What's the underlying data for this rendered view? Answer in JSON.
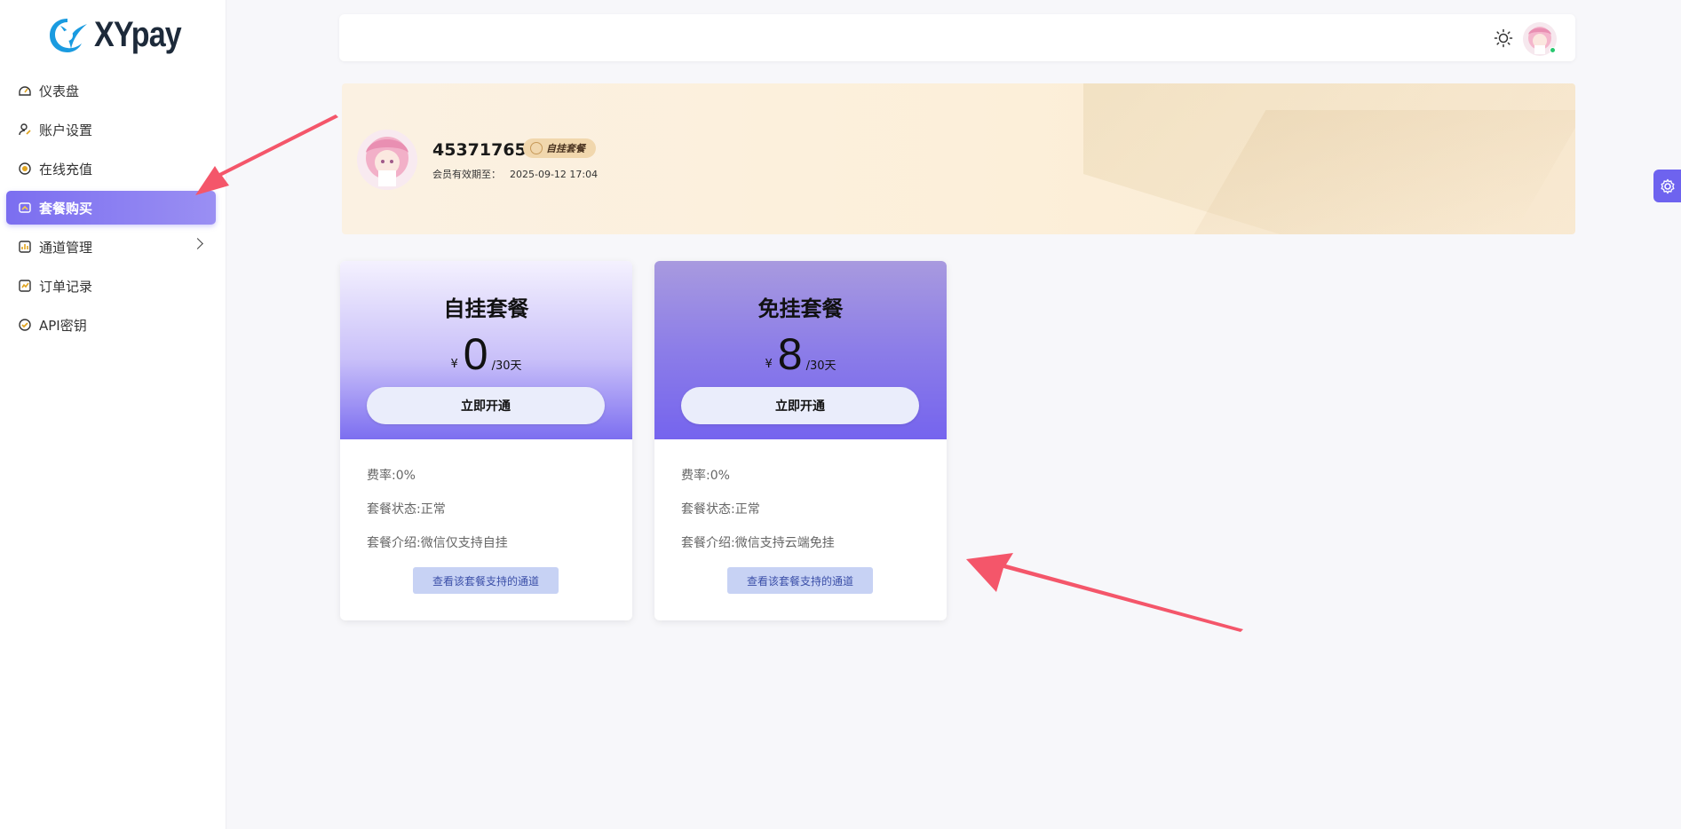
{
  "app": {
    "logo_text": "XYpay"
  },
  "sidebar": {
    "items": [
      {
        "label": "仪表盘",
        "icon": "dashboard-icon"
      },
      {
        "label": "账户设置",
        "icon": "user-settings-icon"
      },
      {
        "label": "在线充值",
        "icon": "coin-icon"
      },
      {
        "label": "套餐购买",
        "icon": "package-icon",
        "active": true
      },
      {
        "label": "通道管理",
        "icon": "chart-icon",
        "has_submenu": true
      },
      {
        "label": "订单记录",
        "icon": "order-icon"
      },
      {
        "label": "API密钥",
        "icon": "key-icon"
      }
    ]
  },
  "header": {
    "theme_icon": "sun-icon"
  },
  "banner": {
    "username": "453717652",
    "badge": "自挂套餐",
    "expire_label": "会员有效期至：",
    "expire_value": "2025-09-12 17:04"
  },
  "cards": [
    {
      "title": "自挂套餐",
      "currency": "¥",
      "price": "0",
      "period": "/30天",
      "button": "立即开通",
      "rate": "费率:0%",
      "status": "套餐状态:正常",
      "intro": "套餐介绍:微信仅支持自挂",
      "channel_button": "查看该套餐支持的通道"
    },
    {
      "title": "免挂套餐",
      "currency": "¥",
      "price": "8",
      "period": "/30天",
      "button": "立即开通",
      "rate": "费率:0%",
      "status": "套餐状态:正常",
      "intro": "套餐介绍:微信支持云端免挂",
      "channel_button": "查看该套餐支持的通道"
    }
  ],
  "colors": {
    "accent": "#7b6ef0",
    "arrow": "#f4566a",
    "badge": "#f1d7ad"
  }
}
